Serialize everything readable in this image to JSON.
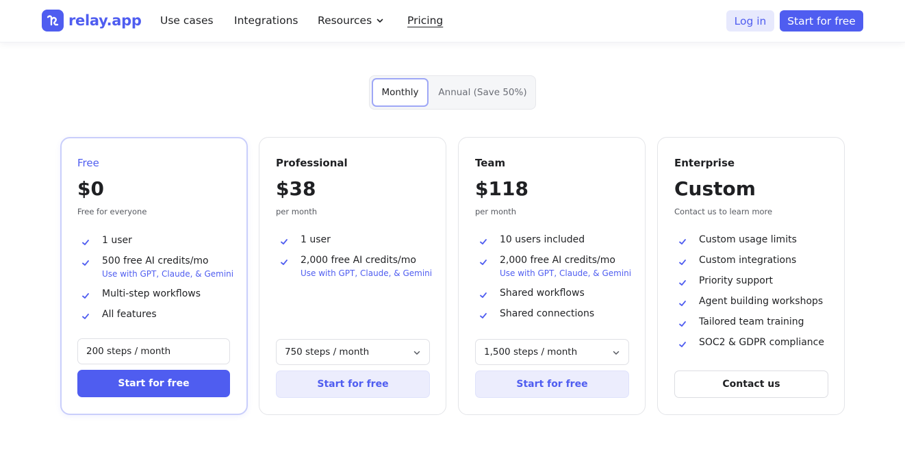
{
  "brand": {
    "name": "relay.app",
    "accent": "#4f5df0",
    "accent_soft": "#ecedfd",
    "logo_icon": "relay-logo-icon"
  },
  "nav": {
    "items": [
      {
        "label": "Use cases"
      },
      {
        "label": "Integrations"
      },
      {
        "label": "Resources",
        "icon": "chevron-down-icon"
      },
      {
        "label": "Pricing"
      }
    ],
    "login_label": "Log in",
    "start_label": "Start for free"
  },
  "billing_toggle": {
    "monthly_label": "Monthly",
    "annual_label": "Annual (Save 50%)",
    "selected": "Monthly"
  },
  "plans": [
    {
      "name": "Free",
      "price": "$0",
      "price_note": "Free for everyone",
      "features": [
        {
          "label": "1 user"
        },
        {
          "label": "500 free AI credits/mo",
          "note": "Use with GPT, Claude, & Gemini"
        },
        {
          "label": "Multi-step workflows"
        },
        {
          "label": "All features"
        }
      ],
      "steps": "200 steps / month",
      "cta": "Start for free"
    },
    {
      "name": "Professional",
      "price": "$38",
      "price_note": "per month",
      "features": [
        {
          "label": "1 user"
        },
        {
          "label": "2,000 free AI credits/mo",
          "note": "Use with GPT, Claude, & Gemini"
        }
      ],
      "steps": "750 steps / month",
      "cta": "Start for free"
    },
    {
      "name": "Team",
      "price": "$118",
      "price_note": "per month",
      "features": [
        {
          "label": "10 users included"
        },
        {
          "label": "2,000 free AI credits/mo",
          "note": "Use with GPT, Claude, & Gemini"
        },
        {
          "label": "Shared workflows"
        },
        {
          "label": "Shared connections"
        }
      ],
      "steps": "1,500 steps / month",
      "cta": "Start for free"
    },
    {
      "name": "Enterprise",
      "price": "Custom",
      "price_note": "Contact us to learn more",
      "features": [
        {
          "label": "Custom usage limits"
        },
        {
          "label": "Custom integrations"
        },
        {
          "label": "Priority support"
        },
        {
          "label": "Agent building workshops"
        },
        {
          "label": "Tailored team training"
        },
        {
          "label": "SOC2 & GDPR compliance"
        }
      ],
      "cta": "Contact us"
    }
  ]
}
